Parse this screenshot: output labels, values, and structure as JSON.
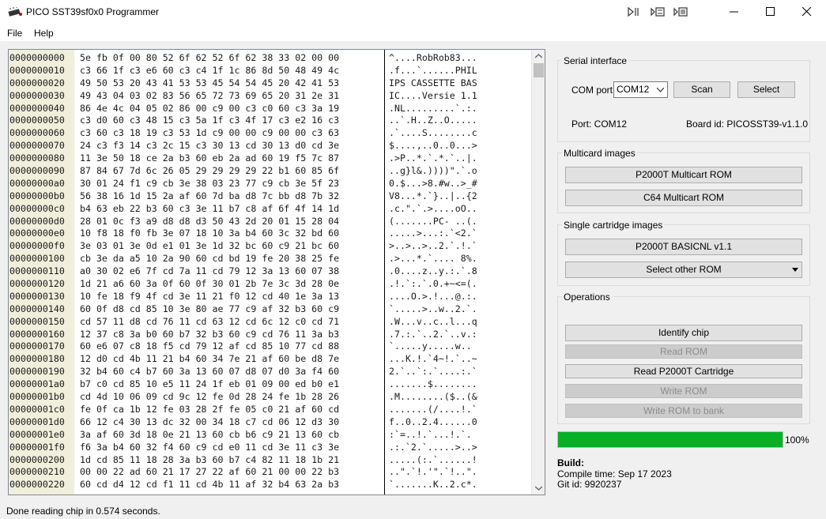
{
  "window": {
    "title": "PICO SST39sf0x0 Programmer"
  },
  "menu": {
    "file": "File",
    "help": "Help"
  },
  "hex": {
    "addresses": [
      "0000000000",
      "0000000010",
      "0000000020",
      "0000000030",
      "0000000040",
      "0000000050",
      "0000000060",
      "0000000070",
      "0000000080",
      "0000000090",
      "00000000a0",
      "00000000b0",
      "00000000c0",
      "00000000d0",
      "00000000e0",
      "00000000f0",
      "0000000100",
      "0000000110",
      "0000000120",
      "0000000130",
      "0000000140",
      "0000000150",
      "0000000160",
      "0000000170",
      "0000000180",
      "0000000190",
      "00000001a0",
      "00000001b0",
      "00000001c0",
      "00000001d0",
      "00000001e0",
      "00000001f0",
      "0000000200",
      "0000000210",
      "0000000220"
    ],
    "bytes": [
      "5e fb 0f 00 80 52 6f 62 52 6f 62 38 33 02 00 00",
      "c3 66 1f c3 e6 60 c3 c4 1f 1c 86 8d 50 48 49 4c",
      "49 50 53 20 43 41 53 53 45 54 54 45 20 42 41 53",
      "49 43 04 03 02 83 56 65 72 73 69 65 20 31 2e 31",
      "86 4e 4c 04 05 02 86 00 c9 00 c3 c0 60 c3 3a 19",
      "c3 d0 60 c3 48 15 c3 5a 1f c3 4f 17 c3 e2 16 c3",
      "c3 60 c3 18 19 c3 53 1d c9 00 00 c9 00 00 c3 63",
      "24 c3 f3 14 c3 2c 15 c3 30 13 cd 30 13 d0 cd 3e",
      "11 3e 50 18 ce 2a b3 60 eb 2a ad 60 19 f5 7c 87",
      "87 84 67 7d 6c 26 05 29 29 29 29 22 b1 60 85 6f",
      "30 01 24 f1 c9 cb 3e 38 03 23 77 c9 cb 3e 5f 23",
      "56 38 16 1d 15 2a af 60 7d ba d8 7c bb d8 7b 32",
      "b4 63 eb 22 b3 60 c3 3e 11 b7 c8 af 6f 4f 14 1d",
      "28 01 0c f3 a9 d8 d8 d3 50 43 2d 20 01 15 28 04",
      "10 f8 18 f0 fb 3e 07 18 10 3a b4 60 3c 32 bd 60",
      "3e 03 01 3e 0d e1 01 3e 1d 32 bc 60 c9 21 bc 60",
      "cb 3e da a5 10 2a 90 60 cd bd 19 fe 20 38 25 fe",
      "a0 30 02 e6 7f cd 7a 11 cd 79 12 3a 13 60 07 38",
      "1d 21 a6 60 3a 0f 60 0f 30 01 2b 7e 3c 3d 28 0e",
      "10 fe 18 f9 4f cd 3e 11 21 f0 12 cd 40 1e 3a 13",
      "60 0f d8 cd 85 10 3e 80 ae 77 c9 af 32 b3 60 c9",
      "cd 57 11 d8 cd 76 11 cd 63 12 cd 6c 12 c0 cd 71",
      "12 37 c8 3a b0 60 b7 32 b3 60 c9 cd 76 11 3a b3",
      "60 e6 07 c8 18 f5 cd 79 12 af cd 85 10 77 cd 88",
      "12 d0 cd 4b 11 21 b4 60 34 7e 21 af 60 be d8 7e",
      "32 b4 60 c4 b7 60 3a 13 60 07 d8 07 d0 3a f4 60",
      "b7 c0 cd 85 10 e5 11 24 1f eb 01 09 00 ed b0 e1",
      "cd 4d 10 06 09 cd 9c 12 fe 0d 28 24 fe 1b 28 26",
      "fe 0f ca 1b 12 fe 03 28 2f fe 05 c0 21 af 60 cd",
      "66 12 c4 30 13 dc 32 00 34 18 c7 cd 06 12 d3 30",
      "3a af 60 3d 18 0e 21 13 60 cb b6 c9 21 13 60 cb",
      "f6 3a b4 60 32 f4 60 c9 cd e0 11 cd 3e 11 c3 3e",
      "1d cd 85 11 18 28 3a b3 60 b7 c4 82 11 18 1b 21",
      "00 00 22 ad 60 21 17 27 22 af 60 21 00 00 22 b3",
      "60 cd d4 12 cd f1 11 cd 4b 11 af 32 b4 63 2a b3"
    ],
    "ascii": [
      "^....RobRob83...",
      ".f...`......PHIL",
      "IPS CASSETTE BAS",
      "IC....Versie 1.1",
      ".NL.........`.:.",
      "..`.H..Z..O.....",
      ".`....S........c",
      "$....,..0..0...>",
      ".>P..*.`.*.`..|.",
      "..g}l&.))))\".`.o",
      "0.$...>8.#w..>_#",
      "V8...*.`}..|..{2",
      ".c.\".`.>....oO..",
      "(.......PC- ..(.",
      ".....>...:.`<2.`",
      ">..>..>..2.`.!.`",
      ".>...*.`.... 8%.",
      ".0....z..y.:.`.8",
      ".!.`:.`.0.+~<=(.",
      "....O.>.!...@.:.",
      "`.....>..w..2.`.",
      ".W...v..c..l...q",
      ".7.:.`..2.`..v.:",
      "`.....y.....w..",
      "...K.!.`4~!.`..~",
      "2.`..`:.`....:.`",
      ".......$........",
      ".M........($..(&",
      ".......(/....!.`",
      "f..0..2.4......0",
      ":`=..!.`...!.`.",
      ".:.`2.`.....>..>",
      ".....(:.`......!",
      "..\".`!.'\".`!..\".",
      "`.......K..2.c*."
    ]
  },
  "serial": {
    "title": "Serial interface",
    "com_label": "COM port",
    "com_value": "COM12",
    "scan_label": "Scan",
    "select_label": "Select",
    "port_text": "Port: COM12",
    "board_text": "Board id: PICOSST39-v1.1.0"
  },
  "multicard": {
    "title": "Multicard images",
    "btn1": "P2000T Multicart ROM",
    "btn2": "C64 Multicart ROM"
  },
  "single": {
    "title": "Single cartridge images",
    "btn1": "P2000T BASICNL v1.1",
    "select_other": "Select other ROM"
  },
  "operations": {
    "title": "Operations",
    "identify": "Identify chip",
    "read_rom": "Read ROM",
    "read_cart": "Read P2000T Cartridge",
    "write_rom": "Write ROM",
    "write_bank": "Write ROM to bank"
  },
  "progress": {
    "value": 100,
    "text": "100%",
    "color": "#06b025"
  },
  "build": {
    "title": "Build:",
    "compile": "Compile time: Sep 17 2023",
    "git": "Git id: 9920237"
  },
  "status": {
    "text": "Done reading chip in 0.574 seconds."
  }
}
